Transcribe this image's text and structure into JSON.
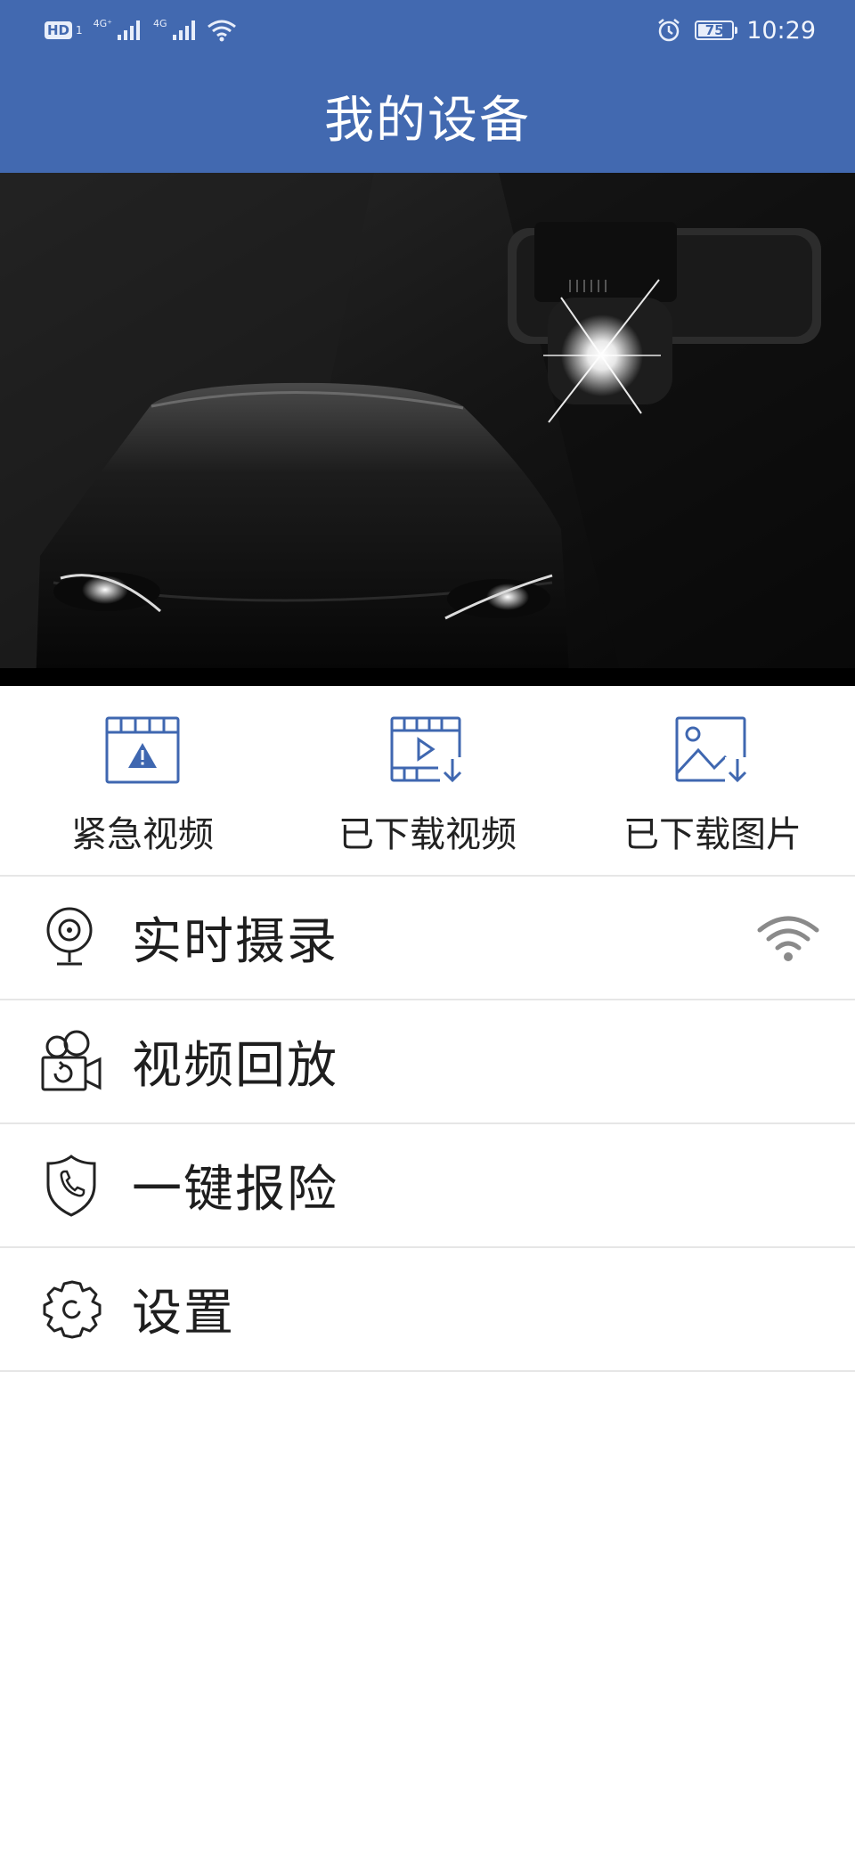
{
  "status_bar": {
    "hd": "HD",
    "sim_slot": "1",
    "net1": "4G⁺",
    "net2": "4G",
    "battery": "75",
    "battery_level": 0.75,
    "time": "10:29",
    "icons": [
      "signal-icon",
      "wifi-icon",
      "alarm-icon",
      "battery-icon"
    ]
  },
  "header": {
    "title": "我的设备"
  },
  "banner": {
    "image": "car-dashcam-night-image"
  },
  "quick_actions": [
    {
      "label": "紧急视频",
      "icon": "emergency-video-icon"
    },
    {
      "label": "已下载视频",
      "icon": "downloaded-video-icon"
    },
    {
      "label": "已下载图片",
      "icon": "downloaded-image-icon"
    }
  ],
  "menu": [
    {
      "label": "实时摄录",
      "icon": "webcam-icon",
      "trailing_icon": "wifi-icon"
    },
    {
      "label": "视频回放",
      "icon": "video-camera-replay-icon"
    },
    {
      "label": "一键报险",
      "icon": "shield-phone-icon"
    },
    {
      "label": "设置",
      "icon": "gear-icon"
    }
  ],
  "colors": {
    "primary": "#4269b0",
    "icon_blue": "#3f67b0",
    "text": "#1e1e1e",
    "divider": "#e6e6e6",
    "wifi_gray": "#8a8a8a"
  }
}
